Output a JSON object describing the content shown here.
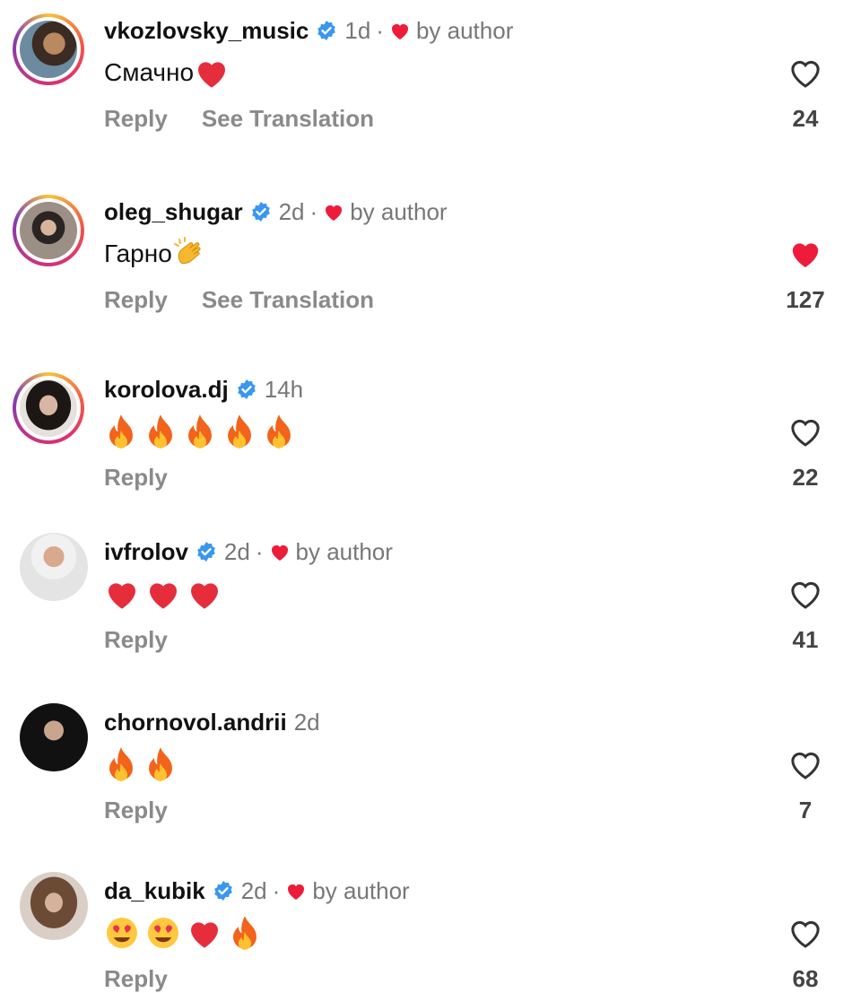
{
  "comments": [
    {
      "username": "vkozlovsky_music",
      "verified": true,
      "time": "1d",
      "dot": "·",
      "by_author": "by author",
      "text": "Смачно",
      "emojis": [
        "red-heart"
      ],
      "reply": "Reply",
      "see_translation": "See Translation",
      "liked": false,
      "likes": "24"
    },
    {
      "username": "oleg_shugar",
      "verified": true,
      "time": "2d",
      "dot": "·",
      "by_author": "by author",
      "text": "Гарно",
      "emojis": [
        "clapping-hands"
      ],
      "reply": "Reply",
      "see_translation": "See Translation",
      "liked": true,
      "likes": "127"
    },
    {
      "username": "korolova.dj",
      "verified": true,
      "time": "14h",
      "text": "",
      "emojis": [
        "fire",
        "fire",
        "fire",
        "fire",
        "fire"
      ],
      "reply": "Reply",
      "liked": false,
      "likes": "22"
    },
    {
      "username": "ivfrolov",
      "verified": true,
      "time": "2d",
      "dot": "·",
      "by_author": "by author",
      "text": "",
      "emojis": [
        "red-heart",
        "red-heart",
        "red-heart"
      ],
      "reply": "Reply",
      "liked": false,
      "likes": "41"
    },
    {
      "username": "chornovol.andrii",
      "verified": false,
      "time": "2d",
      "text": "",
      "emojis": [
        "fire",
        "fire"
      ],
      "reply": "Reply",
      "liked": false,
      "likes": "7"
    },
    {
      "username": "da_kubik",
      "verified": true,
      "time": "2d",
      "dot": "·",
      "by_author": "by author",
      "text": "",
      "emojis": [
        "heart-eyes",
        "heart-eyes",
        "red-heart",
        "fire"
      ],
      "reply": "Reply",
      "liked": false,
      "likes": "68"
    }
  ],
  "colors": {
    "like_red": "#ed1c3a",
    "verified_blue": "#3897f0",
    "muted_text": "#8a8a8a"
  }
}
